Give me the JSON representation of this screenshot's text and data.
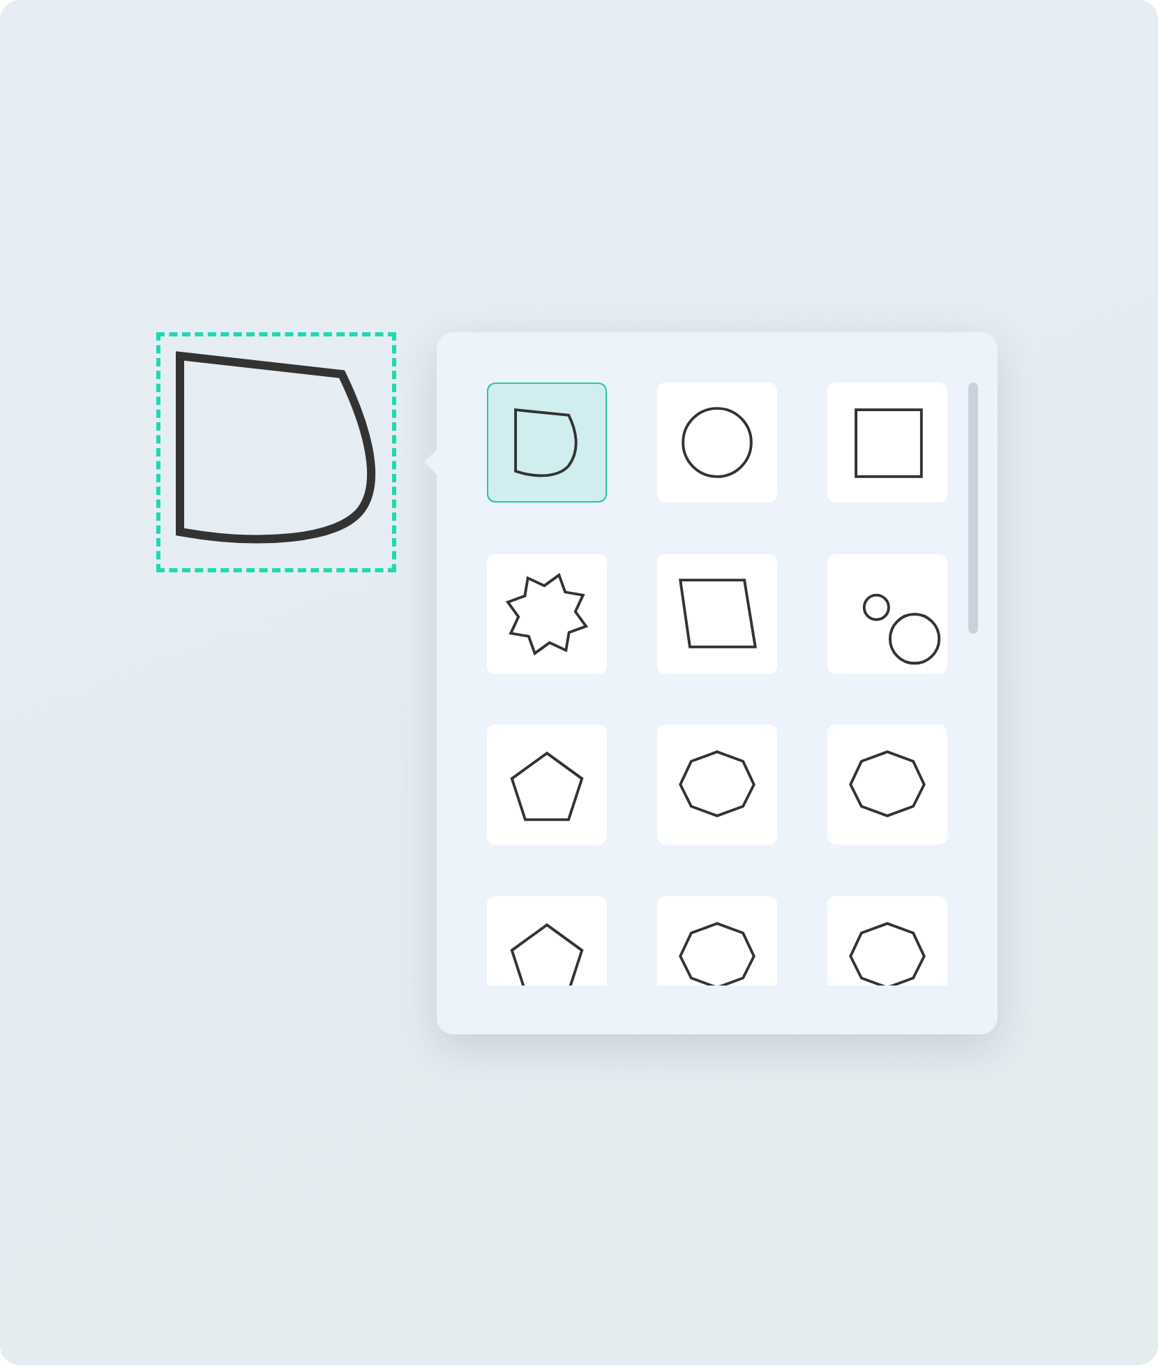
{
  "canvas": {
    "kind": "blob",
    "selected": true
  },
  "shapes": [
    {
      "kind": "blob",
      "selected": true
    },
    {
      "kind": "circle",
      "selected": false
    },
    {
      "kind": "square",
      "selected": false
    },
    {
      "kind": "star",
      "selected": false
    },
    {
      "kind": "parallelogram",
      "selected": false
    },
    {
      "kind": "circles",
      "selected": false
    },
    {
      "kind": "pentagon",
      "selected": false
    },
    {
      "kind": "octagon",
      "selected": false
    },
    {
      "kind": "octagon",
      "selected": false
    },
    {
      "kind": "pentagon",
      "selected": false
    },
    {
      "kind": "octagon",
      "selected": false
    },
    {
      "kind": "octagon",
      "selected": false
    }
  ]
}
